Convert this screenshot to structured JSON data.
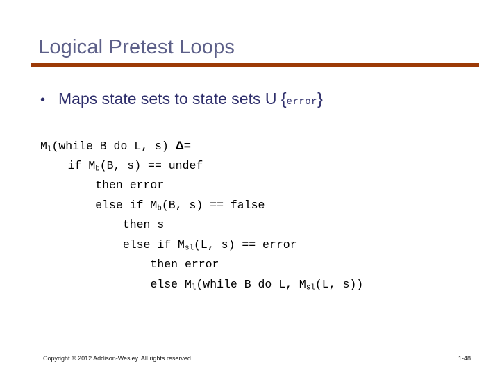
{
  "slide": {
    "title": "Logical Pretest Loops",
    "accent_color": "#9c3a06",
    "title_color": "#5d6089",
    "body_color": "#2e2e6b"
  },
  "bullet": {
    "marker": "•",
    "text_before": "Maps state sets to state sets U ",
    "open_brace": "{",
    "mono_token": "error",
    "close_brace": "}"
  },
  "code": {
    "lines": [
      {
        "indent": "",
        "segments": [
          {
            "kind": "text",
            "value": "M"
          },
          {
            "kind": "sub",
            "value": "l"
          },
          {
            "kind": "text",
            "value": "(while B do L, s) "
          },
          {
            "kind": "delta",
            "value": "Δ="
          }
        ]
      },
      {
        "indent": "    ",
        "segments": [
          {
            "kind": "text",
            "value": "if M"
          },
          {
            "kind": "sub",
            "value": "b"
          },
          {
            "kind": "text",
            "value": "(B, s) == undef"
          }
        ]
      },
      {
        "indent": "        ",
        "segments": [
          {
            "kind": "text",
            "value": "then error"
          }
        ]
      },
      {
        "indent": "        ",
        "segments": [
          {
            "kind": "text",
            "value": "else if M"
          },
          {
            "kind": "sub",
            "value": "b"
          },
          {
            "kind": "text",
            "value": "(B, s) == false"
          }
        ]
      },
      {
        "indent": "            ",
        "segments": [
          {
            "kind": "text",
            "value": "then s"
          }
        ]
      },
      {
        "indent": "            ",
        "segments": [
          {
            "kind": "text",
            "value": "else if M"
          },
          {
            "kind": "sub",
            "value": "sl"
          },
          {
            "kind": "text",
            "value": "(L, s) == error"
          }
        ]
      },
      {
        "indent": "                ",
        "segments": [
          {
            "kind": "text",
            "value": "then error"
          }
        ]
      },
      {
        "indent": "                ",
        "segments": [
          {
            "kind": "text",
            "value": "else M"
          },
          {
            "kind": "sub",
            "value": "l"
          },
          {
            "kind": "text",
            "value": "(while B do L, M"
          },
          {
            "kind": "sub",
            "value": "sl"
          },
          {
            "kind": "text",
            "value": "(L, s))"
          }
        ]
      }
    ]
  },
  "footer": {
    "copyright": "Copyright © 2012 Addison-Wesley. All rights reserved.",
    "page_number": "1-48"
  }
}
